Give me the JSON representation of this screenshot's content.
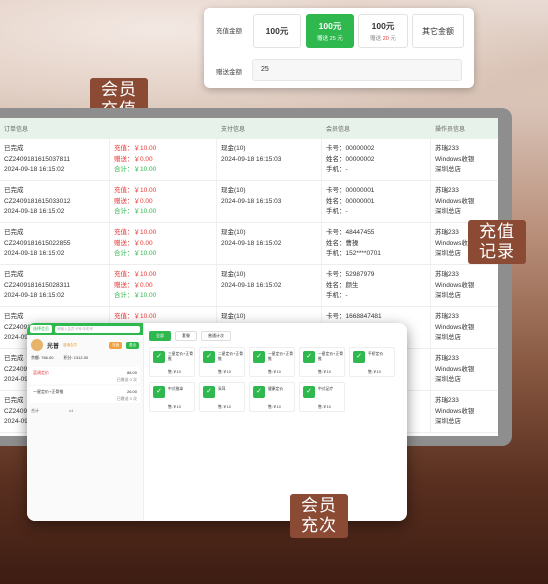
{
  "recharge": {
    "amount_label": "充值金额",
    "gift_label": "赠送金额",
    "gift_value": "25",
    "options": [
      {
        "main": "100元",
        "sub": "",
        "active": false
      },
      {
        "main": "100元",
        "sub": "赠送 25 元",
        "active": true
      },
      {
        "main": "100元",
        "sub_prefix": "赠送",
        "sub_red": "20",
        "sub_suffix": "元",
        "active": false
      },
      {
        "main": "其它金额",
        "sub": "",
        "active": false
      }
    ]
  },
  "badges": {
    "member_recharge": "会员充值",
    "recharge_record": "充值记录",
    "member_times": "会员充次"
  },
  "table": {
    "headers": [
      "订单信息",
      "",
      "支付信息",
      "会员信息",
      "操作员信息"
    ],
    "rows": [
      {
        "status": "已完成",
        "order": "CZ2409181615037811",
        "time": "2024-09-18 16:15:02",
        "recharge": "充值：￥10.00",
        "gift": "赠送：￥0.00",
        "total": "合计：￥10.00",
        "pay": "现金(10)",
        "pay_time": "2024-09-18 16:15:03",
        "card": "卡号：00000002",
        "name": "姓名：00000002",
        "phone": "手机：-",
        "op": "苏瑞233",
        "op2": "Windows收银",
        "op3": "深圳总店"
      },
      {
        "status": "已完成",
        "order": "CZ2409181615033012",
        "time": "2024-09-18 16:15:02",
        "recharge": "充值：￥10.00",
        "gift": "赠送：￥0.00",
        "total": "合计：￥10.00",
        "pay": "现金(10)",
        "pay_time": "2024-09-18 16:15:03",
        "card": "卡号：00000001",
        "name": "姓名：00000001",
        "phone": "手机：-",
        "op": "苏瑞233",
        "op2": "Windows收银",
        "op3": "深圳总店"
      },
      {
        "status": "已完成",
        "order": "CZ2409181615022855",
        "time": "2024-09-18 16:15:02",
        "recharge": "充值：￥10.00",
        "gift": "赠送：￥0.00",
        "total": "合计：￥10.00",
        "pay": "现金(10)",
        "pay_time": "2024-09-18 16:15:02",
        "card": "卡号：48447455",
        "name": "姓名：曹操",
        "phone": "手机：152****0701",
        "op": "苏瑞233",
        "op2": "Windows收银",
        "op3": "深圳总店"
      },
      {
        "status": "已完成",
        "order": "CZ2409181615028311",
        "time": "2024-09-18 16:15:02",
        "recharge": "充值：￥10.00",
        "gift": "赠送：￥0.00",
        "total": "合计：￥10.00",
        "pay": "现金(10)",
        "pay_time": "2024-09-18 16:15:02",
        "card": "卡号：52987979",
        "name": "姓名：颜生",
        "phone": "手机：-",
        "op": "苏瑞233",
        "op2": "Windows收银",
        "op3": "深圳总店"
      },
      {
        "status": "已完成",
        "order": "CZ2409181615025183",
        "time": "2024-09-18 16:15:02",
        "recharge": "充值：￥10.00",
        "gift": "赠送：￥0.00",
        "total": "合计：￥10.00",
        "pay": "现金(10)",
        "pay_time": "2024-09-18 16:15:02",
        "card": "卡号：1668847481",
        "name": "姓名：1668847481",
        "phone": "手机：-",
        "op": "苏瑞233",
        "op2": "Windows收银",
        "op3": "深圳总店"
      },
      {
        "status": "已完成",
        "order": "CZ2409181615021002",
        "time": "2024-09-18 16:15:02",
        "recharge": "",
        "gift": "",
        "total": "",
        "pay": "",
        "pay_time": "",
        "card": "",
        "name": "",
        "phone": "",
        "op": "苏瑞233",
        "op2": "Windows收银",
        "op3": "深圳总店"
      },
      {
        "status": "已完成",
        "order": "CZ2409181615020001",
        "time": "2024-09-18 16:15:02",
        "recharge": "",
        "gift": "",
        "total": "",
        "pay": "",
        "pay_time": "",
        "card": "",
        "name": "",
        "phone": "",
        "op": "苏瑞233",
        "op2": "Windows收银",
        "op3": "深圳总店"
      }
    ]
  },
  "pos": {
    "member_chip": "选择会员",
    "search_placeholder": "请输入会员卡号/手机号",
    "member_name": "光普",
    "member_tag": "普通会员",
    "balance": "余额: 766.00",
    "points": "积分: 1312.00",
    "btn1": "充值",
    "btn2": "退出",
    "cart": [
      {
        "name": "蓝调定价",
        "price": "88.00",
        "sub": "已赠送 0 次"
      },
      {
        "name": "一星定价+正骨推",
        "price": "26.00",
        "sub": "已赠送 0 次"
      }
    ],
    "footer_left": "合计",
    "footer_right": "x1",
    "tabs": [
      "全部",
      "套餐",
      "普通计次"
    ],
    "products": [
      {
        "name": "三星定价+正骨推",
        "price": "售:￥10"
      },
      {
        "name": "二星定价+正骨推",
        "price": "售:￥10"
      },
      {
        "name": "一星定价+正骨推",
        "price": "售:￥10"
      },
      {
        "name": "一星定价+正骨推",
        "price": "售:￥10"
      },
      {
        "name": "平桥定价",
        "price": "售:￥10"
      },
      {
        "name": "中式推拿",
        "price": "售:￥10"
      },
      {
        "name": "采耳",
        "price": "售:￥10"
      },
      {
        "name": "健康定价",
        "price": "售:￥10"
      },
      {
        "name": "中式足疗",
        "price": "售:￥10"
      }
    ]
  }
}
